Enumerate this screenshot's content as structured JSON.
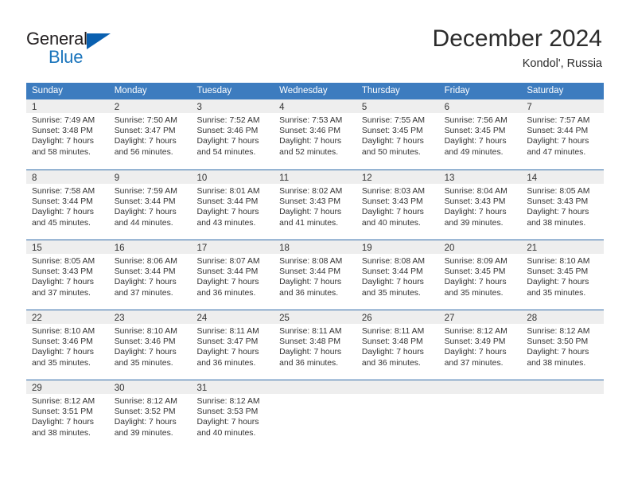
{
  "brand": {
    "name_top": "General",
    "name_bottom": "Blue",
    "top_color": "#231f20",
    "bottom_color": "#1b75bc",
    "triangle_color": "#0a60b0"
  },
  "header": {
    "title": "December 2024",
    "subtitle": "Kondol', Russia"
  },
  "theme": {
    "header_row_bg": "#3d7cbf",
    "header_row_text": "#ffffff",
    "daynum_band_bg": "#eeeeee",
    "week_divider": "#2e6aa8",
    "body_text": "#333333"
  },
  "weekdays": [
    "Sunday",
    "Monday",
    "Tuesday",
    "Wednesday",
    "Thursday",
    "Friday",
    "Saturday"
  ],
  "weeks": [
    [
      {
        "day": "1",
        "sunrise": "Sunrise: 7:49 AM",
        "sunset": "Sunset: 3:48 PM",
        "daylight_line1": "Daylight: 7 hours",
        "daylight_line2": "and 58 minutes."
      },
      {
        "day": "2",
        "sunrise": "Sunrise: 7:50 AM",
        "sunset": "Sunset: 3:47 PM",
        "daylight_line1": "Daylight: 7 hours",
        "daylight_line2": "and 56 minutes."
      },
      {
        "day": "3",
        "sunrise": "Sunrise: 7:52 AM",
        "sunset": "Sunset: 3:46 PM",
        "daylight_line1": "Daylight: 7 hours",
        "daylight_line2": "and 54 minutes."
      },
      {
        "day": "4",
        "sunrise": "Sunrise: 7:53 AM",
        "sunset": "Sunset: 3:46 PM",
        "daylight_line1": "Daylight: 7 hours",
        "daylight_line2": "and 52 minutes."
      },
      {
        "day": "5",
        "sunrise": "Sunrise: 7:55 AM",
        "sunset": "Sunset: 3:45 PM",
        "daylight_line1": "Daylight: 7 hours",
        "daylight_line2": "and 50 minutes."
      },
      {
        "day": "6",
        "sunrise": "Sunrise: 7:56 AM",
        "sunset": "Sunset: 3:45 PM",
        "daylight_line1": "Daylight: 7 hours",
        "daylight_line2": "and 49 minutes."
      },
      {
        "day": "7",
        "sunrise": "Sunrise: 7:57 AM",
        "sunset": "Sunset: 3:44 PM",
        "daylight_line1": "Daylight: 7 hours",
        "daylight_line2": "and 47 minutes."
      }
    ],
    [
      {
        "day": "8",
        "sunrise": "Sunrise: 7:58 AM",
        "sunset": "Sunset: 3:44 PM",
        "daylight_line1": "Daylight: 7 hours",
        "daylight_line2": "and 45 minutes."
      },
      {
        "day": "9",
        "sunrise": "Sunrise: 7:59 AM",
        "sunset": "Sunset: 3:44 PM",
        "daylight_line1": "Daylight: 7 hours",
        "daylight_line2": "and 44 minutes."
      },
      {
        "day": "10",
        "sunrise": "Sunrise: 8:01 AM",
        "sunset": "Sunset: 3:44 PM",
        "daylight_line1": "Daylight: 7 hours",
        "daylight_line2": "and 43 minutes."
      },
      {
        "day": "11",
        "sunrise": "Sunrise: 8:02 AM",
        "sunset": "Sunset: 3:43 PM",
        "daylight_line1": "Daylight: 7 hours",
        "daylight_line2": "and 41 minutes."
      },
      {
        "day": "12",
        "sunrise": "Sunrise: 8:03 AM",
        "sunset": "Sunset: 3:43 PM",
        "daylight_line1": "Daylight: 7 hours",
        "daylight_line2": "and 40 minutes."
      },
      {
        "day": "13",
        "sunrise": "Sunrise: 8:04 AM",
        "sunset": "Sunset: 3:43 PM",
        "daylight_line1": "Daylight: 7 hours",
        "daylight_line2": "and 39 minutes."
      },
      {
        "day": "14",
        "sunrise": "Sunrise: 8:05 AM",
        "sunset": "Sunset: 3:43 PM",
        "daylight_line1": "Daylight: 7 hours",
        "daylight_line2": "and 38 minutes."
      }
    ],
    [
      {
        "day": "15",
        "sunrise": "Sunrise: 8:05 AM",
        "sunset": "Sunset: 3:43 PM",
        "daylight_line1": "Daylight: 7 hours",
        "daylight_line2": "and 37 minutes."
      },
      {
        "day": "16",
        "sunrise": "Sunrise: 8:06 AM",
        "sunset": "Sunset: 3:44 PM",
        "daylight_line1": "Daylight: 7 hours",
        "daylight_line2": "and 37 minutes."
      },
      {
        "day": "17",
        "sunrise": "Sunrise: 8:07 AM",
        "sunset": "Sunset: 3:44 PM",
        "daylight_line1": "Daylight: 7 hours",
        "daylight_line2": "and 36 minutes."
      },
      {
        "day": "18",
        "sunrise": "Sunrise: 8:08 AM",
        "sunset": "Sunset: 3:44 PM",
        "daylight_line1": "Daylight: 7 hours",
        "daylight_line2": "and 36 minutes."
      },
      {
        "day": "19",
        "sunrise": "Sunrise: 8:08 AM",
        "sunset": "Sunset: 3:44 PM",
        "daylight_line1": "Daylight: 7 hours",
        "daylight_line2": "and 35 minutes."
      },
      {
        "day": "20",
        "sunrise": "Sunrise: 8:09 AM",
        "sunset": "Sunset: 3:45 PM",
        "daylight_line1": "Daylight: 7 hours",
        "daylight_line2": "and 35 minutes."
      },
      {
        "day": "21",
        "sunrise": "Sunrise: 8:10 AM",
        "sunset": "Sunset: 3:45 PM",
        "daylight_line1": "Daylight: 7 hours",
        "daylight_line2": "and 35 minutes."
      }
    ],
    [
      {
        "day": "22",
        "sunrise": "Sunrise: 8:10 AM",
        "sunset": "Sunset: 3:46 PM",
        "daylight_line1": "Daylight: 7 hours",
        "daylight_line2": "and 35 minutes."
      },
      {
        "day": "23",
        "sunrise": "Sunrise: 8:10 AM",
        "sunset": "Sunset: 3:46 PM",
        "daylight_line1": "Daylight: 7 hours",
        "daylight_line2": "and 35 minutes."
      },
      {
        "day": "24",
        "sunrise": "Sunrise: 8:11 AM",
        "sunset": "Sunset: 3:47 PM",
        "daylight_line1": "Daylight: 7 hours",
        "daylight_line2": "and 36 minutes."
      },
      {
        "day": "25",
        "sunrise": "Sunrise: 8:11 AM",
        "sunset": "Sunset: 3:48 PM",
        "daylight_line1": "Daylight: 7 hours",
        "daylight_line2": "and 36 minutes."
      },
      {
        "day": "26",
        "sunrise": "Sunrise: 8:11 AM",
        "sunset": "Sunset: 3:48 PM",
        "daylight_line1": "Daylight: 7 hours",
        "daylight_line2": "and 36 minutes."
      },
      {
        "day": "27",
        "sunrise": "Sunrise: 8:12 AM",
        "sunset": "Sunset: 3:49 PM",
        "daylight_line1": "Daylight: 7 hours",
        "daylight_line2": "and 37 minutes."
      },
      {
        "day": "28",
        "sunrise": "Sunrise: 8:12 AM",
        "sunset": "Sunset: 3:50 PM",
        "daylight_line1": "Daylight: 7 hours",
        "daylight_line2": "and 38 minutes."
      }
    ],
    [
      {
        "day": "29",
        "sunrise": "Sunrise: 8:12 AM",
        "sunset": "Sunset: 3:51 PM",
        "daylight_line1": "Daylight: 7 hours",
        "daylight_line2": "and 38 minutes."
      },
      {
        "day": "30",
        "sunrise": "Sunrise: 8:12 AM",
        "sunset": "Sunset: 3:52 PM",
        "daylight_line1": "Daylight: 7 hours",
        "daylight_line2": "and 39 minutes."
      },
      {
        "day": "31",
        "sunrise": "Sunrise: 8:12 AM",
        "sunset": "Sunset: 3:53 PM",
        "daylight_line1": "Daylight: 7 hours",
        "daylight_line2": "and 40 minutes."
      },
      {
        "day": "",
        "sunrise": "",
        "sunset": "",
        "daylight_line1": "",
        "daylight_line2": ""
      },
      {
        "day": "",
        "sunrise": "",
        "sunset": "",
        "daylight_line1": "",
        "daylight_line2": ""
      },
      {
        "day": "",
        "sunrise": "",
        "sunset": "",
        "daylight_line1": "",
        "daylight_line2": ""
      },
      {
        "day": "",
        "sunrise": "",
        "sunset": "",
        "daylight_line1": "",
        "daylight_line2": ""
      }
    ]
  ]
}
